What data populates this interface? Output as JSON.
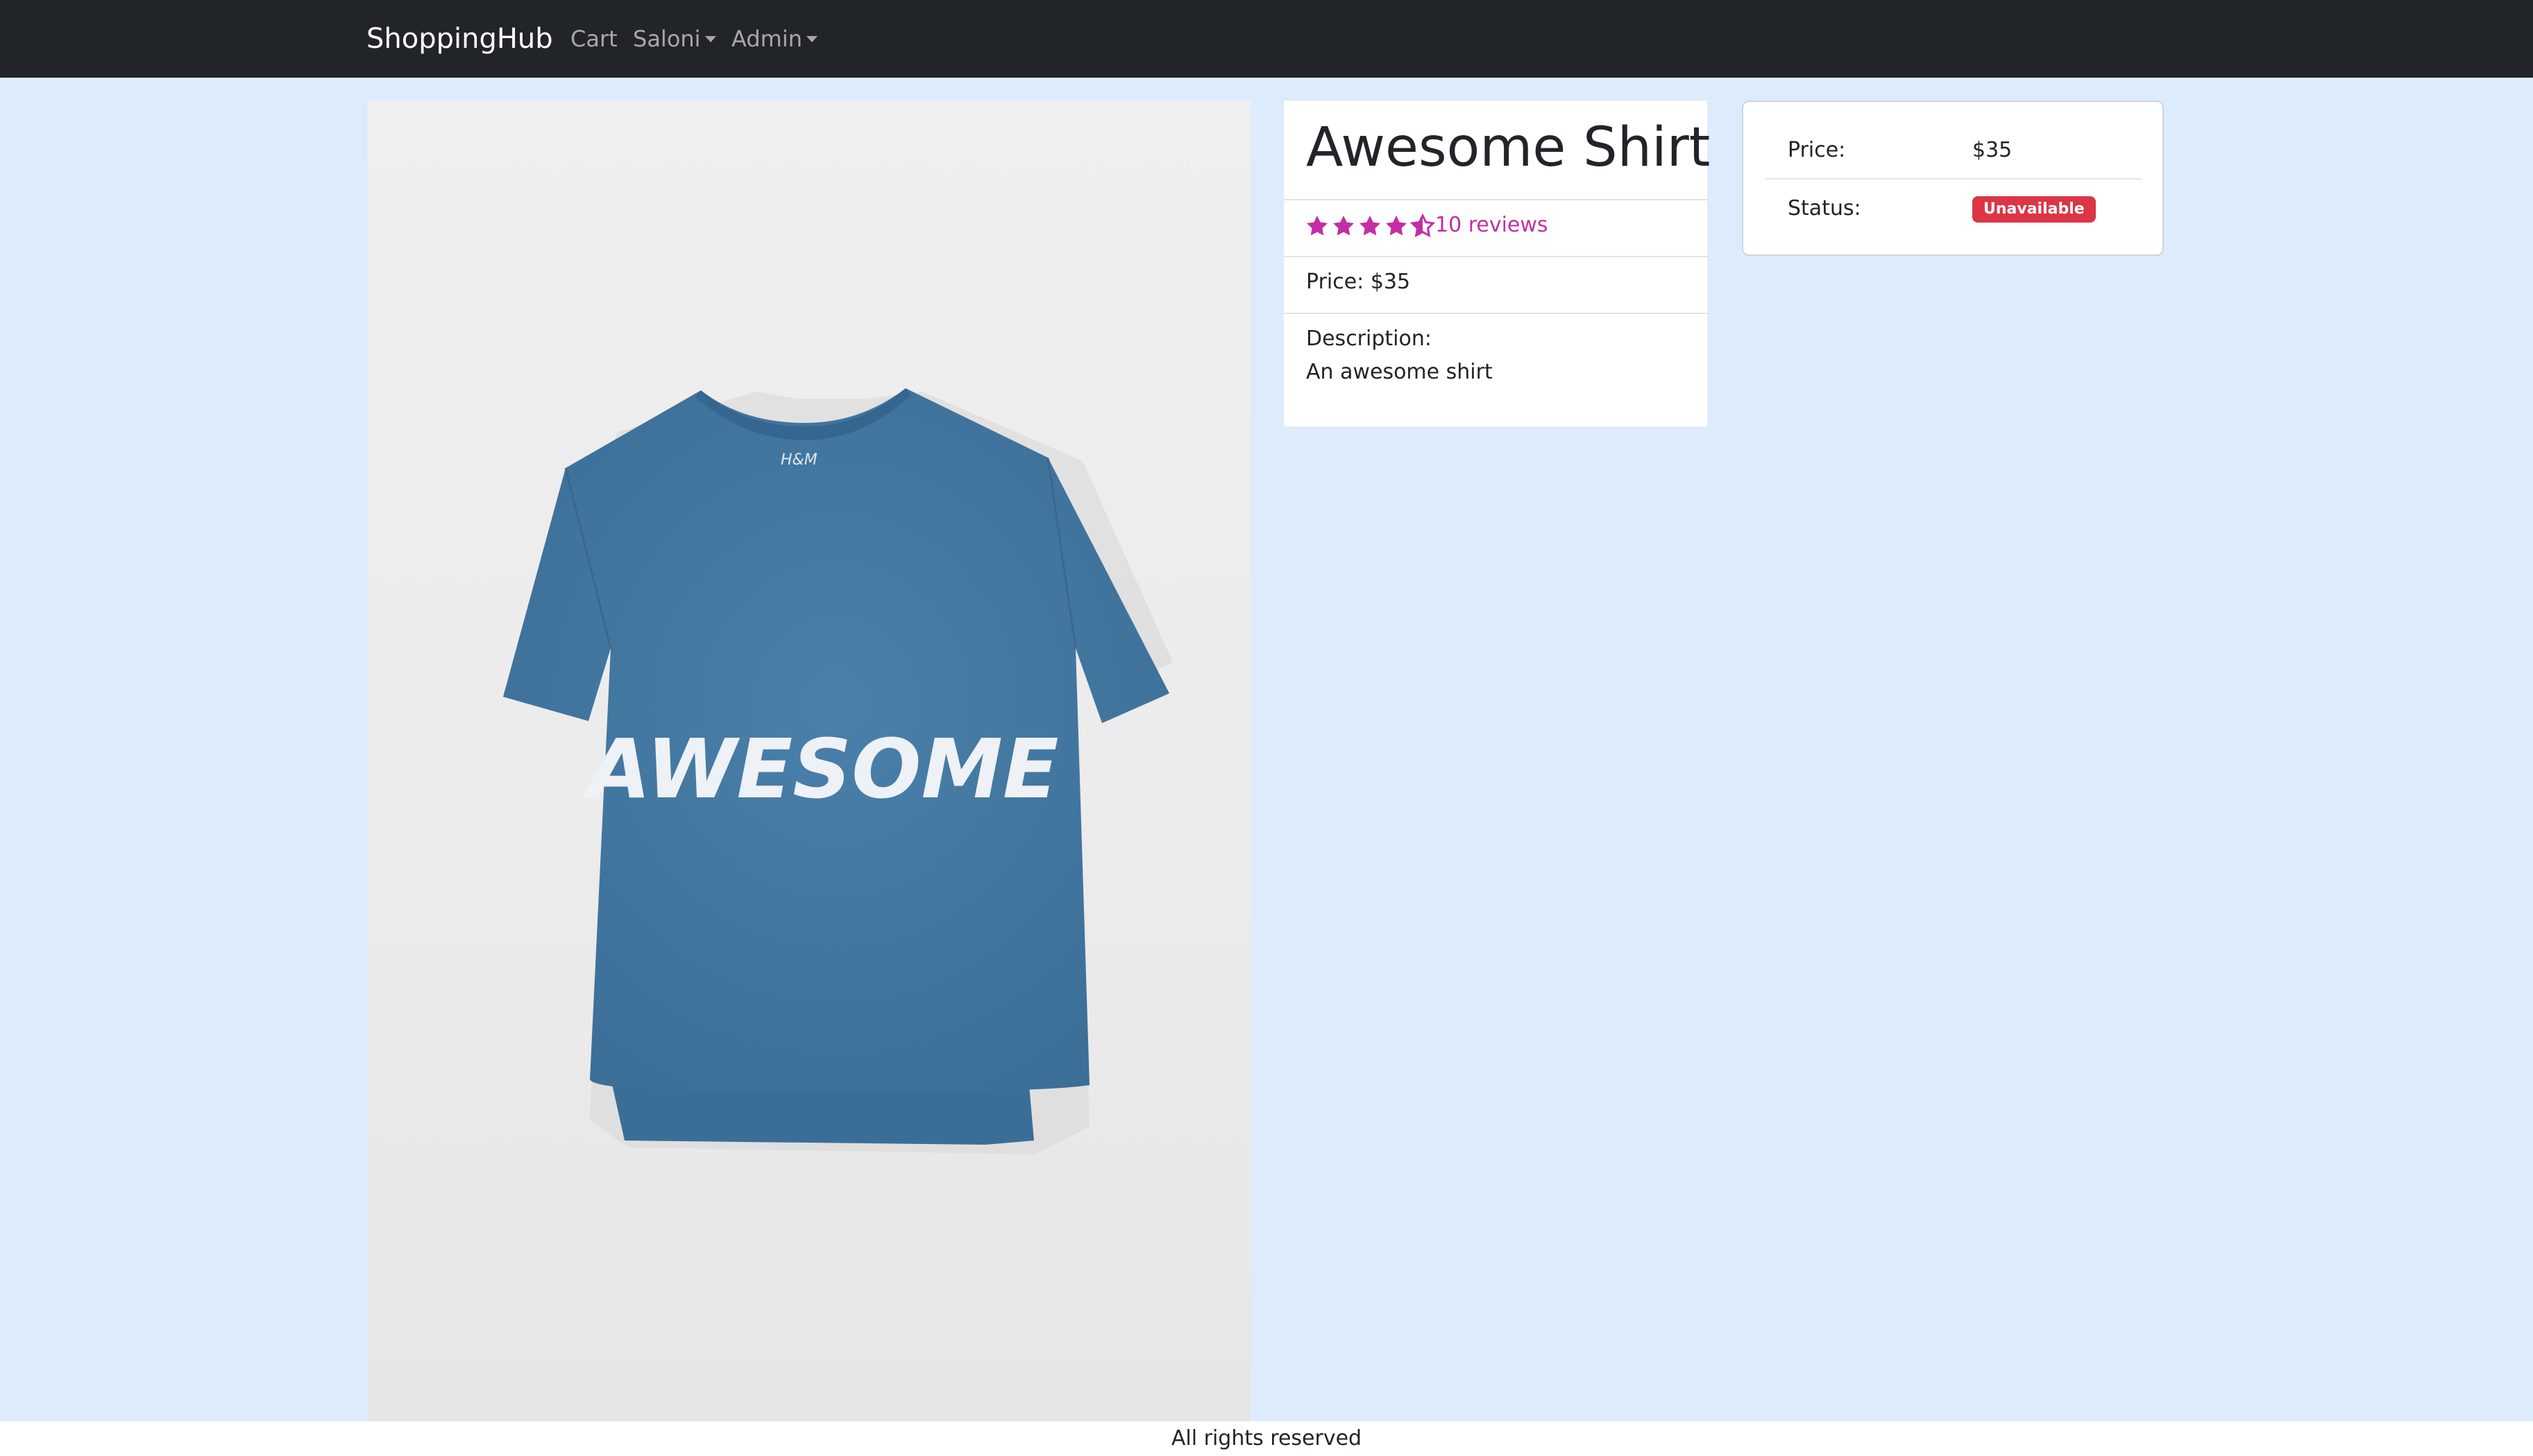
{
  "navbar": {
    "brand": "ShoppingHub",
    "links": [
      {
        "label": "Cart"
      },
      {
        "label": "Saloni"
      },
      {
        "label": "Admin"
      }
    ]
  },
  "product": {
    "title": "Awesome Shirt",
    "image_text": "AWESOME",
    "image_label": "H&M",
    "rating": 4.5,
    "reviews_label": "10 reviews",
    "price_line": "Price: $35",
    "description_label": "Description:",
    "description": "An awesome shirt"
  },
  "purchase": {
    "price_label": "Price:",
    "price_value": "$35",
    "status_label": "Status:",
    "status_value": "Unavailable"
  },
  "footer": {
    "text": "All rights reserved"
  },
  "colors": {
    "page_bg": "#dcecfd",
    "navbar_bg": "#212529",
    "star": "#c22fa5",
    "badge_danger": "#dc3545",
    "shirt": "#40769f"
  }
}
